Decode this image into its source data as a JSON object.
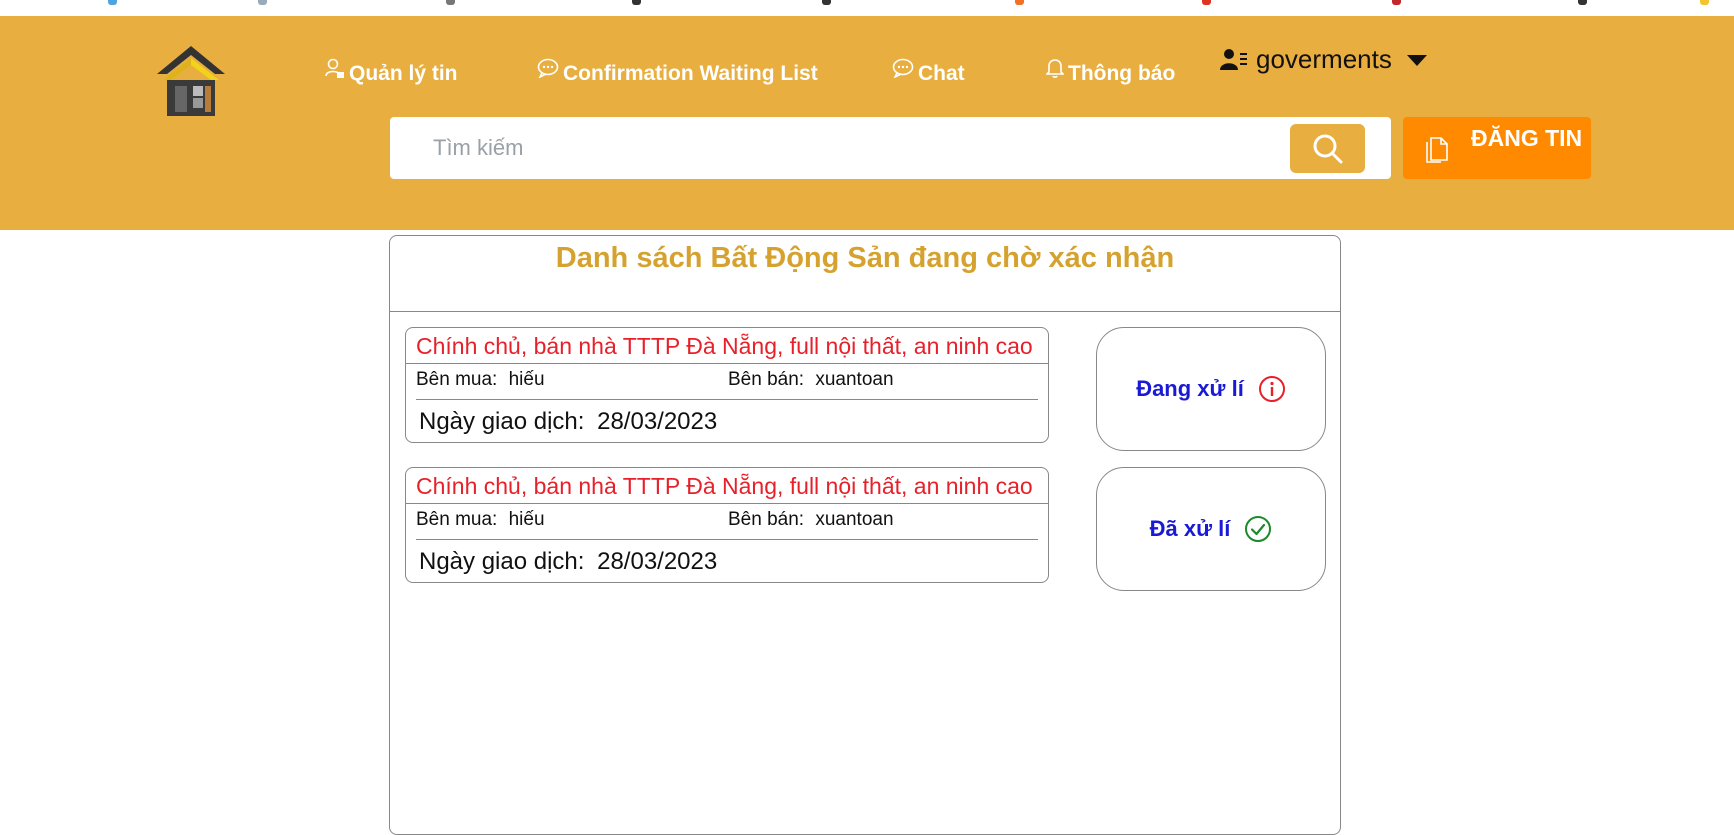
{
  "header": {
    "nav": {
      "manage_posts": "Quản lý tin",
      "confirmation_list": "Confirmation Waiting List",
      "chat": "Chat",
      "notifications": "Thông báo"
    },
    "user": {
      "name": "goverments"
    },
    "search": {
      "placeholder": "Tìm kiếm"
    },
    "post_button": "ĐĂNG TIN"
  },
  "panel": {
    "title": "Danh sách Bất Động Sản đang chờ xác nhận",
    "transactions": [
      {
        "title": "Chính chủ, bán nhà TTTP Đà Nẵng, full nội thất, an ninh cao",
        "buyer_label": "Bên mua:",
        "buyer": "hiếu",
        "seller_label": "Bên bán:",
        "seller": "xuantoan",
        "date_label": "Ngày giao dịch:",
        "date": "28/03/2023",
        "status": "Đang xử lí",
        "status_icon": "info-icon"
      },
      {
        "title": "Chính chủ, bán nhà TTTP Đà Nẵng, full nội thất, an ninh cao",
        "buyer_label": "Bên mua:",
        "buyer": "hiếu",
        "seller_label": "Bên bán:",
        "seller": "xuantoan",
        "date_label": "Ngày giao dịch:",
        "date": "28/03/2023",
        "status": "Đã xử lí",
        "status_icon": "check-circle-icon"
      }
    ]
  },
  "colors": {
    "header_bg": "#e8ae40",
    "post_button_bg": "#ff8a00",
    "title_gold": "#d6a22f",
    "listing_title_red": "#e8202a",
    "status_text_blue": "#1a1ad6",
    "status_pending_red": "#e8202a",
    "status_done_green": "#1b8a2a"
  }
}
